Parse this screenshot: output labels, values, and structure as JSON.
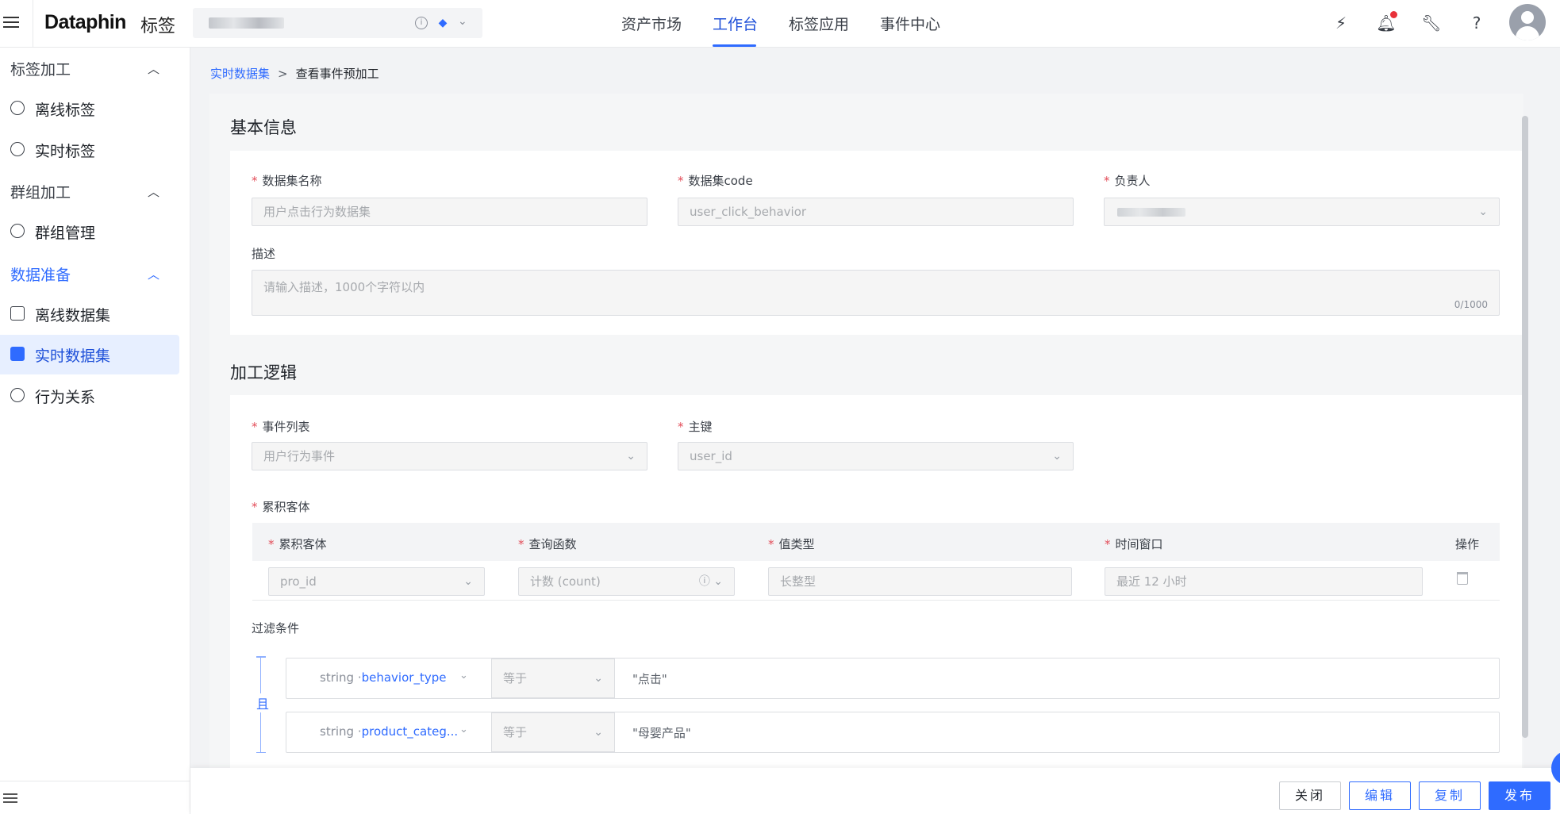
{
  "header": {
    "logo": "Dataphin",
    "logo_sub": "标签",
    "nav": [
      "资产市场",
      "工作台",
      "标签应用",
      "事件中心"
    ],
    "active_nav": "工作台"
  },
  "sidebar": {
    "groups": [
      {
        "label": "标签加工",
        "items": [
          "离线标签",
          "实时标签"
        ]
      },
      {
        "label": "群组加工",
        "items": [
          "群组管理"
        ]
      },
      {
        "label": "数据准备",
        "items": [
          "离线数据集",
          "实时数据集",
          "行为关系"
        ]
      }
    ],
    "active_item": "实时数据集"
  },
  "breadcrumb": {
    "parent": "实时数据集",
    "separator": ">",
    "current": "查看事件预加工"
  },
  "basic_info": {
    "title": "基本信息",
    "name_label": "数据集名称",
    "name_value": "用户点击行为数据集",
    "code_label": "数据集code",
    "code_value": "user_click_behavior",
    "owner_label": "负责人",
    "desc_label": "描述",
    "desc_placeholder": "请输入描述，1000个字符以内",
    "desc_counter": "0/1000"
  },
  "logic": {
    "title": "加工逻辑",
    "event_list_label": "事件列表",
    "event_list_value": "用户行为事件",
    "pk_label": "主键",
    "pk_value": "user_id",
    "accum_label": "累积客体",
    "table": {
      "headers": [
        "累积客体",
        "查询函数",
        "值类型",
        "时间窗口",
        "操作"
      ],
      "row": {
        "accum": "pro_id",
        "func": "计数 (count)",
        "value_type": "长整型",
        "window": "最近 12 小时"
      }
    },
    "filter_label": "过滤条件",
    "and_label": "且",
    "filters": [
      {
        "type": "string",
        "field": "behavior_type",
        "op": "等于",
        "value": "\"点击\""
      },
      {
        "type": "string",
        "field": "product_categ...",
        "op": "等于",
        "value": "\"母婴产品\""
      }
    ]
  },
  "footer": {
    "close": "关闭",
    "edit": "编辑",
    "copy": "复制",
    "publish": "发布"
  }
}
